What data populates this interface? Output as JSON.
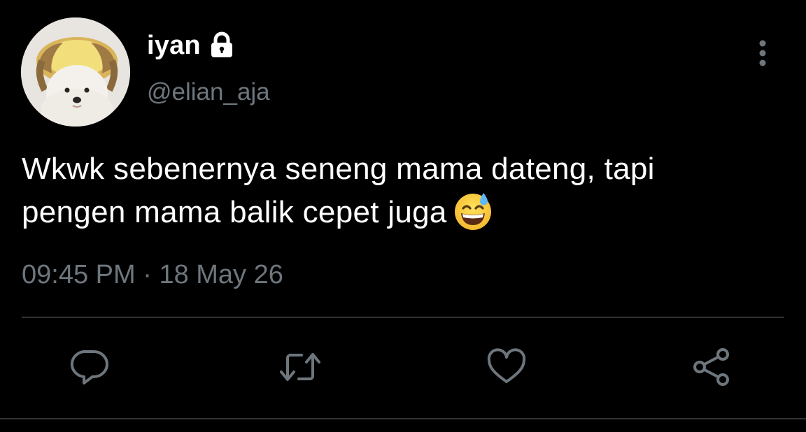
{
  "tweet": {
    "display_name": "iyan",
    "handle": "@elian_aja",
    "text_line1": "Wkwk sebenernya seneng mama dateng, tapi",
    "text_line2": "pengen mama balik cepet juga",
    "emoji": "grinning-face-with-sweat",
    "time": "09:45 PM",
    "separator": " · ",
    "date": "18 May 26",
    "protected": true
  },
  "icons": {
    "lock": "lock-icon",
    "more": "more-vertical-icon",
    "reply": "reply-icon",
    "retweet": "retweet-icon",
    "like": "heart-icon",
    "share": "share-icon"
  },
  "colors": {
    "background": "#000000",
    "text_primary": "#ffffff",
    "text_secondary": "#6e767d",
    "divider": "#2f3336"
  }
}
